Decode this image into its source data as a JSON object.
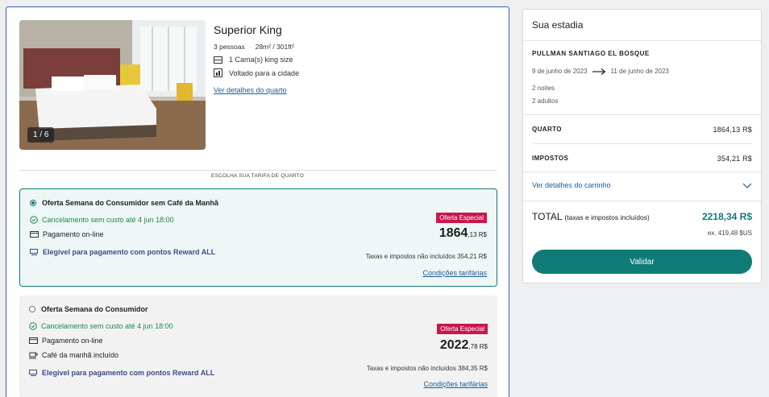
{
  "room": {
    "title": "Superior King",
    "guests": "3 pessoas",
    "size": "28m² / 301ft²",
    "bed": "1 Cama(s) king size",
    "view": "Voltado para a cidade",
    "details_link": "Ver detalhes do quarto",
    "photo_counter": "1 / 6"
  },
  "rates_heading": "ESCOLHA SUA TARIFA DE QUARTO",
  "rates": [
    {
      "title": "Oferta Semana do Consumidor sem Café da Manhã",
      "selected": true,
      "cancellation": "Cancelamento sem custo até 4 jun 18:00",
      "payment": "Pagamento on-line",
      "reward": "Elegível para pagamento com pontos Reward ALL",
      "badge": "Oferta Especial",
      "price_int": "1864",
      "price_dec": ",13 R$",
      "taxes": "Taxas e impostos não incluídos 354,21 R$",
      "conditions": "Condições tarifárias"
    },
    {
      "title": "Oferta Semana do Consumidor",
      "selected": false,
      "cancellation": "Cancelamento sem custo até 4 jun 18:00",
      "payment": "Pagamento on-line",
      "breakfast": "Café da manhã incluído",
      "reward": "Elegível para pagamento com pontos Reward ALL",
      "badge": "Oferta Especial",
      "price_int": "2022",
      "price_dec": ",78 R$",
      "taxes": "Taxas e impostos não incluídos 384,35 R$",
      "conditions": "Condições tarifárias"
    }
  ],
  "summary": {
    "title": "Sua estadia",
    "hotel": "PULLMAN SANTIAGO EL BOSQUE",
    "checkin": "9 de junho de 2023",
    "checkout": "11 de junho de 2023",
    "nights": "2 noites",
    "adults": "2 adultos",
    "room_label": "QUARTO",
    "room_value": "1864,13 R$",
    "tax_label": "IMPOSTOS",
    "tax_value": "354,21 R$",
    "cart_link": "Ver detalhes do carrinho",
    "total_label": "TOTAL",
    "total_sub": "(taxas e impostos incluídos)",
    "total_value": "2218,34 R$",
    "total_usd": "ex. 419,48 $US",
    "validate": "Validar"
  },
  "colors": {
    "accent": "#0f7b78",
    "badge": "#c8174d",
    "link": "#1d5d94",
    "reward": "#3a4c8c"
  }
}
